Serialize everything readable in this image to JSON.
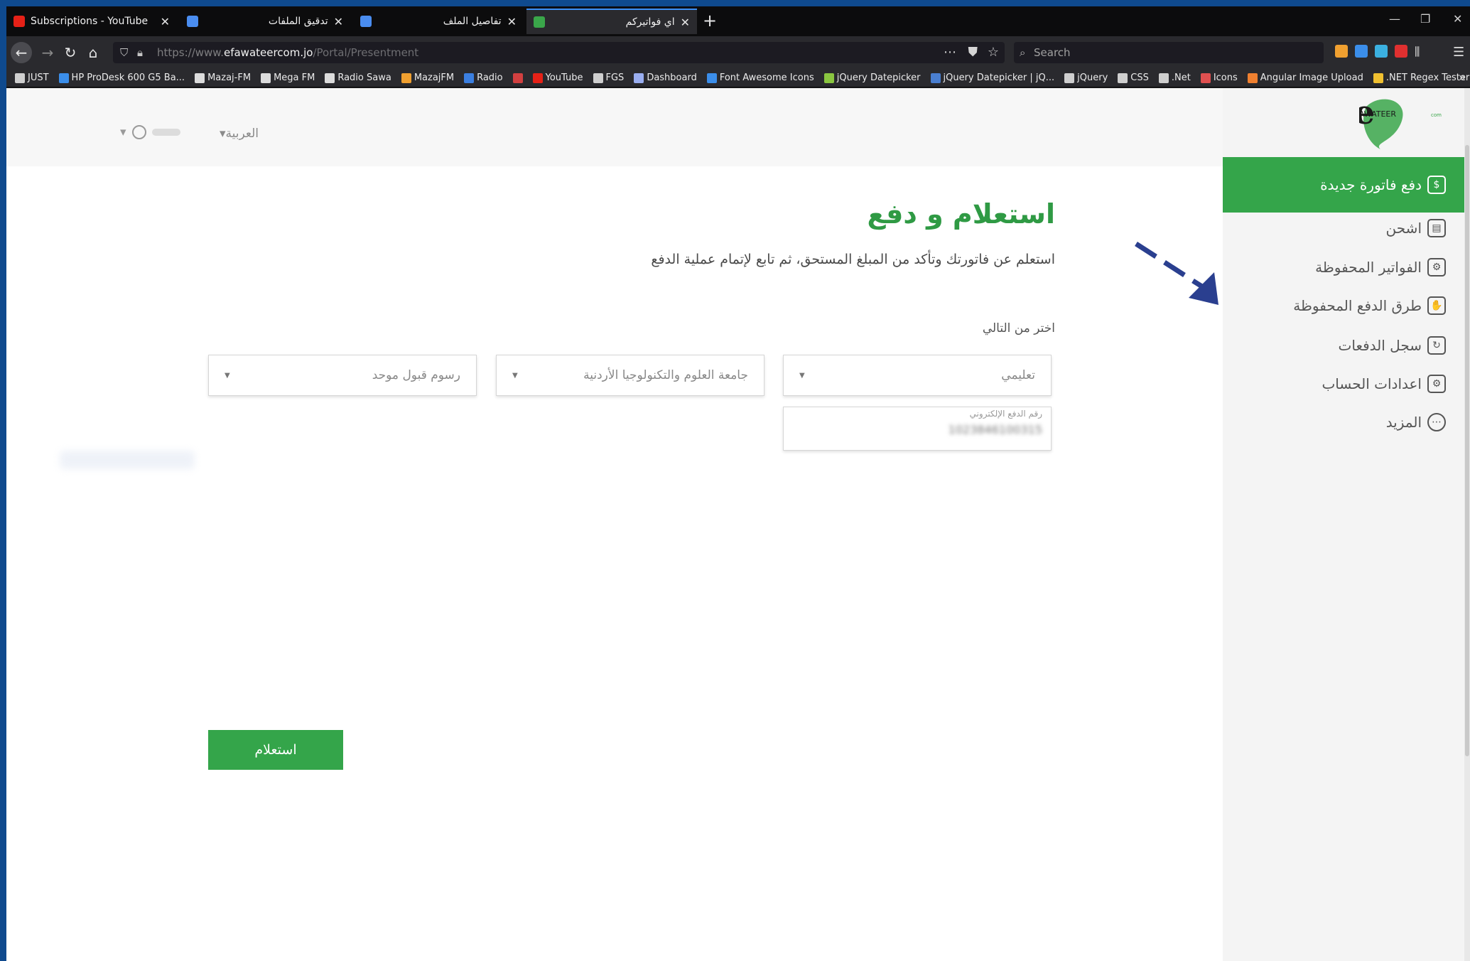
{
  "browser": {
    "tabs": [
      {
        "title": "Subscriptions - YouTube",
        "favicon_color": "#e62117"
      },
      {
        "title": "تدقيق الملفات",
        "favicon_color": "#4a8df0"
      },
      {
        "title": "تفاصيل الملف",
        "favicon_color": "#4a8df0"
      },
      {
        "title": "اي فواتيركم",
        "favicon_color": "#3aa64a"
      }
    ],
    "new_tab": "+",
    "url": {
      "prefix": "https://www.",
      "host": "efawateercom.jo",
      "path": "/Portal/Presentment"
    },
    "search_placeholder": "Search",
    "bookmarks": [
      {
        "label": "JUST",
        "color": "#cfcfcf"
      },
      {
        "label": "HP ProDesk 600 G5 Ba...",
        "color": "#3b8eea"
      },
      {
        "label": "Mazaj-FM",
        "color": "#dcdcdc"
      },
      {
        "label": "Mega FM",
        "color": "#dcdcdc"
      },
      {
        "label": "Radio Sawa",
        "color": "#dcdcdc"
      },
      {
        "label": "MazajFM",
        "color": "#f0a030"
      },
      {
        "label": "Radio",
        "color": "#3b7fe0"
      },
      {
        "label": "",
        "color": "#d24040"
      },
      {
        "label": "YouTube",
        "color": "#e62117"
      },
      {
        "label": "FGS",
        "color": "#cfcfcf"
      },
      {
        "label": "Dashboard",
        "color": "#9aaef0"
      },
      {
        "label": "Font Awesome Icons",
        "color": "#3b8eea"
      },
      {
        "label": "jQuery Datepicker",
        "color": "#8ac640"
      },
      {
        "label": "jQuery Datepicker | jQ...",
        "color": "#4a7fd0"
      },
      {
        "label": "jQuery",
        "color": "#cfcfcf"
      },
      {
        "label": "CSS",
        "color": "#cfcfcf"
      },
      {
        "label": ".Net",
        "color": "#cfcfcf"
      },
      {
        "label": "Icons",
        "color": "#e05050"
      },
      {
        "label": "Angular Image Upload",
        "color": "#f08030"
      },
      {
        "label": ".NET Regex Tester",
        "color": "#f0c030"
      }
    ],
    "bookmarks_more": "»"
  },
  "header": {
    "language": "العربية",
    "user_caret": "▾"
  },
  "sidebar": {
    "logo_text": "FAWATEER",
    "logo_suffix": "com",
    "items": [
      {
        "label": "دفع فاتورة جديدة",
        "icon": "bill-icon",
        "glyph": "$"
      },
      {
        "label": "اشحن",
        "icon": "mobile-icon",
        "glyph": "▤"
      },
      {
        "label": "الفواتير المحفوظة",
        "icon": "saved-bills-icon",
        "glyph": "⚙"
      },
      {
        "label": "طرق الدفع المحفوظة",
        "icon": "card-icon",
        "glyph": "✋"
      },
      {
        "label": "سجل الدفعات",
        "icon": "history-icon",
        "glyph": "↻"
      },
      {
        "label": "اعدادات الحساب",
        "icon": "gear-icon",
        "glyph": "⚙"
      },
      {
        "label": "المزيد",
        "icon": "more-icon",
        "glyph": "⋯"
      }
    ]
  },
  "main": {
    "title": "استعلام و دفع",
    "subtitle": "استعلم عن فاتورتك وتأكد من المبلغ المستحق، ثم تابع لإتمام عملية الدفع",
    "select_label": "اختر من التالي",
    "selects": [
      {
        "value": "تعليمي"
      },
      {
        "value": "جامعة العلوم والتكنولوجيا الأردنية"
      },
      {
        "value": "رسوم قبول موحد"
      }
    ],
    "epay_label": "رقم الدفع الإلكتروني",
    "epay_value": "1023846100315",
    "inquire_button": "استعلام"
  },
  "colors": {
    "accent": "#34a54a",
    "title_green": "#2f9a44",
    "arrow": "#2a3f8f"
  }
}
